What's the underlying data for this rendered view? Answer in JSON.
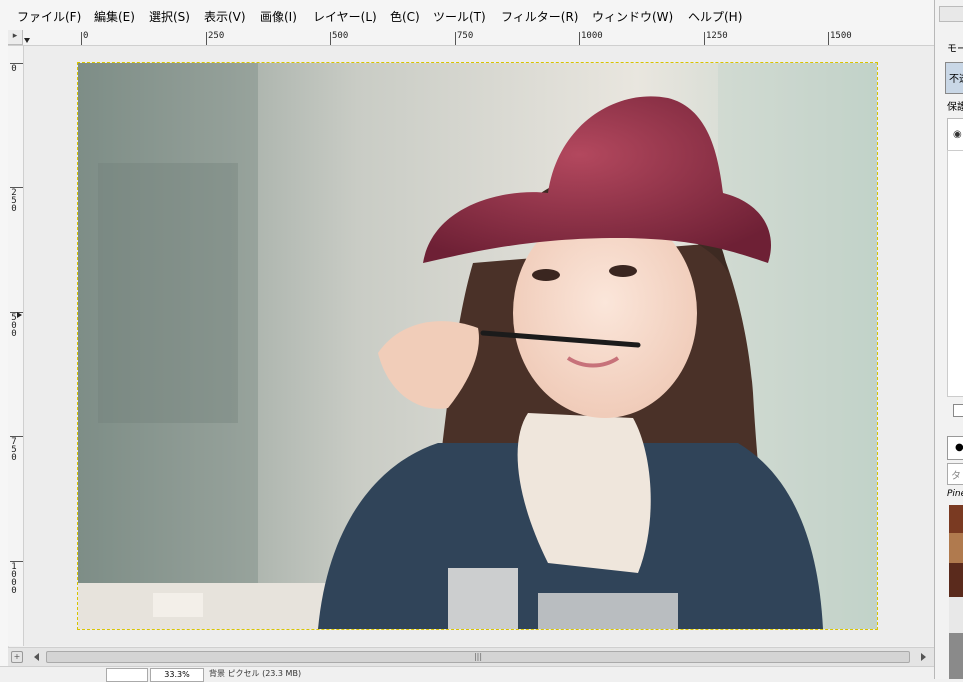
{
  "menu": [
    {
      "label": "ファイル(F)"
    },
    {
      "label": "編集(E)"
    },
    {
      "label": "選択(S)"
    },
    {
      "label": "表示(V)"
    },
    {
      "label": "画像(I)"
    },
    {
      "label": "レイヤー(L)"
    },
    {
      "label": "色(C)"
    },
    {
      "label": "ツール(T)"
    },
    {
      "label": "フィルター(R)"
    },
    {
      "label": "ウィンドウ(W)"
    },
    {
      "label": "ヘルプ(H)"
    }
  ],
  "ruler": {
    "top_labels": [
      "0",
      "250",
      "500",
      "750",
      "1000",
      "1250",
      "1500"
    ],
    "left_labels": [
      "0",
      "250",
      "500",
      "750",
      "1000"
    ]
  },
  "statusbar": {
    "zoom": "33.3%",
    "info": "背景 ピクセル (23.3 MB)"
  },
  "right_panel": {
    "mode_label": "モー",
    "mode_value": "不透",
    "lock_label": "保護",
    "filter_placeholder": "タ",
    "brush_name": "Pine"
  },
  "canvas": {
    "background": "#ededed",
    "selection_color": "#d8c400"
  }
}
